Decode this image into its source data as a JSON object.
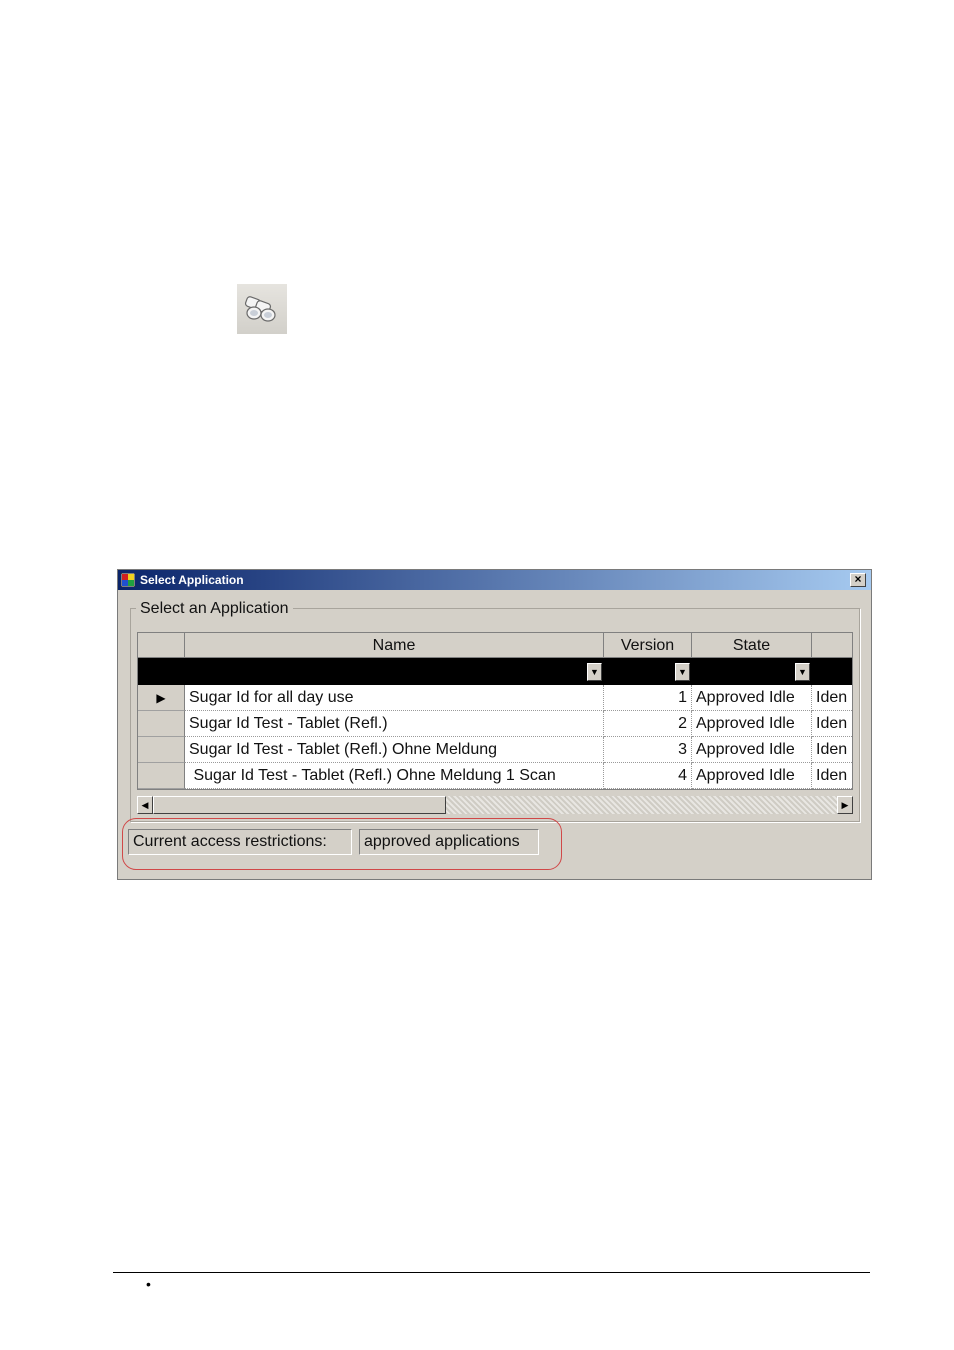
{
  "toolbar": {
    "binoculars_icon": "binoculars-icon"
  },
  "dialog": {
    "title": "Select Application",
    "close_label": "×",
    "group_title": "Select an Application",
    "columns": [
      "Name",
      "Version",
      "State"
    ],
    "rows": [
      {
        "name": "Sugar Id for all day use",
        "version": "1",
        "state": "Approved Idle",
        "extra": "Iden",
        "current": true
      },
      {
        "name": "Sugar Id Test - Tablet (Refl.)",
        "version": "2",
        "state": "Approved Idle",
        "extra": "Iden",
        "current": false
      },
      {
        "name": "Sugar Id Test - Tablet (Refl.) Ohne Meldung",
        "version": "3",
        "state": "Approved Idle",
        "extra": "Iden",
        "current": false
      },
      {
        "name": " Sugar Id Test - Tablet (Refl.) Ohne Meldung 1 Scan",
        "version": "4",
        "state": "Approved Idle",
        "extra": "Iden",
        "current": false
      }
    ],
    "restrictions_label": "Current access restrictions:",
    "restrictions_value": "approved applications",
    "highlight_color": "#d04848"
  },
  "footer": {
    "bullet": "•"
  }
}
